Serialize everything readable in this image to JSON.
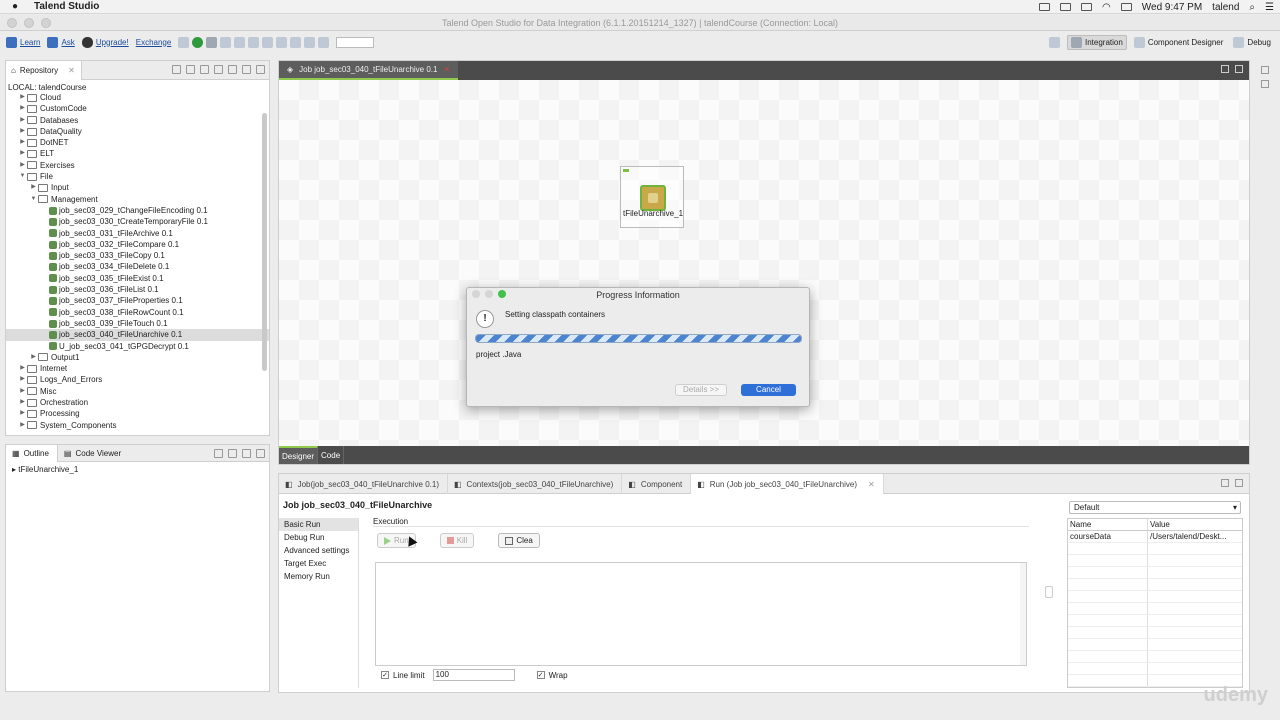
{
  "menubar": {
    "app_name": "Talend Studio",
    "clock": "Wed 9:47 PM",
    "user": "talend"
  },
  "window": {
    "title": "Talend Open Studio for Data Integration (6.1.1.20151214_1327) | talendCourse (Connection: Local)"
  },
  "toolbar": {
    "learn": "Learn",
    "ask": "Ask",
    "upgrade": "Upgrade!",
    "exchange": "Exchange"
  },
  "perspectives": {
    "integration": "Integration",
    "component_designer": "Component Designer",
    "debug": "Debug"
  },
  "repository": {
    "tab_label": "Repository",
    "root": "LOCAL: talendCourse",
    "items": [
      {
        "label": "Cloud",
        "level": 0,
        "type": "folder",
        "arrow": "▶"
      },
      {
        "label": "CustomCode",
        "level": 0,
        "type": "folder",
        "arrow": "▶"
      },
      {
        "label": "Databases",
        "level": 0,
        "type": "folder",
        "arrow": "▶"
      },
      {
        "label": "DataQuality",
        "level": 0,
        "type": "folder",
        "arrow": "▶"
      },
      {
        "label": "DotNET",
        "level": 0,
        "type": "folder",
        "arrow": "▶"
      },
      {
        "label": "ELT",
        "level": 0,
        "type": "folder",
        "arrow": "▶"
      },
      {
        "label": "Exercises",
        "level": 0,
        "type": "folder",
        "arrow": "▶"
      },
      {
        "label": "File",
        "level": 0,
        "type": "folder",
        "arrow": "▼"
      },
      {
        "label": "Input",
        "level": 1,
        "type": "folder",
        "arrow": "▶"
      },
      {
        "label": "Management",
        "level": 1,
        "type": "folder",
        "arrow": "▼"
      },
      {
        "label": "job_sec03_029_tChangeFileEncoding 0.1",
        "level": 2,
        "type": "job",
        "arrow": ""
      },
      {
        "label": "job_sec03_030_tCreateTemporaryFile 0.1",
        "level": 2,
        "type": "job",
        "arrow": ""
      },
      {
        "label": "job_sec03_031_tFileArchive 0.1",
        "level": 2,
        "type": "job",
        "arrow": ""
      },
      {
        "label": "job_sec03_032_tFileCompare 0.1",
        "level": 2,
        "type": "job",
        "arrow": ""
      },
      {
        "label": "job_sec03_033_tFileCopy 0.1",
        "level": 2,
        "type": "job",
        "arrow": ""
      },
      {
        "label": "job_sec03_034_tFileDelete 0.1",
        "level": 2,
        "type": "job",
        "arrow": ""
      },
      {
        "label": "job_sec03_035_tFileExist 0.1",
        "level": 2,
        "type": "job",
        "arrow": ""
      },
      {
        "label": "job_sec03_036_tFileList 0.1",
        "level": 2,
        "type": "job",
        "arrow": ""
      },
      {
        "label": "job_sec03_037_tFileProperties 0.1",
        "level": 2,
        "type": "job",
        "arrow": ""
      },
      {
        "label": "job_sec03_038_tFileRowCount 0.1",
        "level": 2,
        "type": "job",
        "arrow": ""
      },
      {
        "label": "job_sec03_039_tFileTouch 0.1",
        "level": 2,
        "type": "job",
        "arrow": ""
      },
      {
        "label": "job_sec03_040_tFileUnarchive 0.1",
        "level": 2,
        "type": "job",
        "arrow": "",
        "selected": true
      },
      {
        "label": "U_job_sec03_041_tGPGDecrypt 0.1",
        "level": 2,
        "type": "job",
        "arrow": ""
      },
      {
        "label": "Output1",
        "level": 1,
        "type": "folder",
        "arrow": "▶"
      },
      {
        "label": "Internet",
        "level": 0,
        "type": "folder",
        "arrow": "▶"
      },
      {
        "label": "Logs_And_Errors",
        "level": 0,
        "type": "folder",
        "arrow": "▶"
      },
      {
        "label": "Misc",
        "level": 0,
        "type": "folder",
        "arrow": "▶"
      },
      {
        "label": "Orchestration",
        "level": 0,
        "type": "folder",
        "arrow": "▶"
      },
      {
        "label": "Processing",
        "level": 0,
        "type": "folder",
        "arrow": "▶"
      },
      {
        "label": "System_Components",
        "level": 0,
        "type": "folder",
        "arrow": "▶"
      }
    ]
  },
  "outline": {
    "tab_outline": "Outline",
    "tab_code_viewer": "Code Viewer",
    "item": "tFileUnarchive_1"
  },
  "editor": {
    "tab_label": "Job job_sec03_040_tFileUnarchive 0.1",
    "component_label": "tFileUnarchive_1",
    "designer_tab": "Designer",
    "code_tab": "Code"
  },
  "run_view": {
    "tabs": [
      {
        "label": "Job(job_sec03_040_tFileUnarchive 0.1)",
        "active": false
      },
      {
        "label": "Contexts(job_sec03_040_tFileUnarchive)",
        "active": false
      },
      {
        "label": "Component",
        "active": false
      },
      {
        "label": "Run (Job job_sec03_040_tFileUnarchive)",
        "active": true
      }
    ],
    "title": "Job job_sec03_040_tFileUnarchive",
    "side_items": [
      "Basic Run",
      "Debug Run",
      "Advanced settings",
      "Target Exec",
      "Memory Run"
    ],
    "execution_label": "Execution",
    "run_button": "Run",
    "kill_button": "Kill",
    "clear_button": "Clea",
    "line_limit_label": "Line limit",
    "line_limit_value": "100",
    "wrap_label": "Wrap",
    "context_select": "Default",
    "context_headers": [
      "Name",
      "Value"
    ],
    "context_rows": [
      {
        "name": "courseData",
        "value": "/Users/talend/Deskt..."
      }
    ]
  },
  "dialog": {
    "title": "Progress Information",
    "message": "Setting classpath containers",
    "subtask": "project .Java",
    "details_button": "Details >>",
    "cancel_button": "Cancel"
  },
  "watermark": "udemy"
}
